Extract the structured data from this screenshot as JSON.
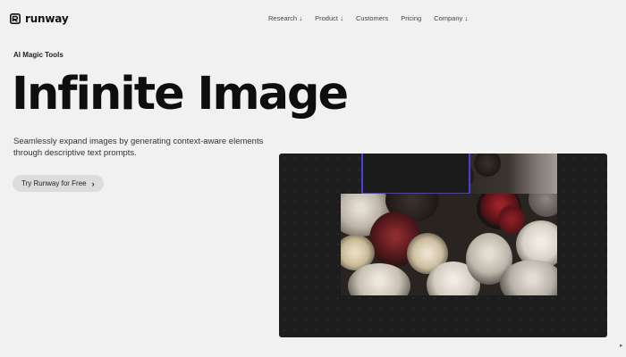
{
  "header": {
    "logo_text": "runway",
    "nav": [
      {
        "label": "Research",
        "has_dropdown": true
      },
      {
        "label": "Product",
        "has_dropdown": true
      },
      {
        "label": "Customers",
        "has_dropdown": false
      },
      {
        "label": "Pricing",
        "has_dropdown": false
      },
      {
        "label": "Company",
        "has_dropdown": true
      }
    ],
    "dropdown_glyph": "↓"
  },
  "hero": {
    "eyebrow": "AI Magic Tools",
    "title": "Infinite Image",
    "subtitle_line1": "Seamlessly expand images by generating context-aware elements",
    "subtitle_line2": "through descriptive text prompts.",
    "cta_label": "Try Runway for Free",
    "cta_icon": "chevron-right-icon"
  },
  "demo": {
    "canvas_color": "#1d1d1d",
    "selection_color": "#4a3ed8",
    "image_subject": "bouquet of white roses, cream carnations and dark red dahlias"
  },
  "colors": {
    "page_background": "#f1f1f1",
    "text": "#111111",
    "cta_background": "#dcdcdc"
  }
}
